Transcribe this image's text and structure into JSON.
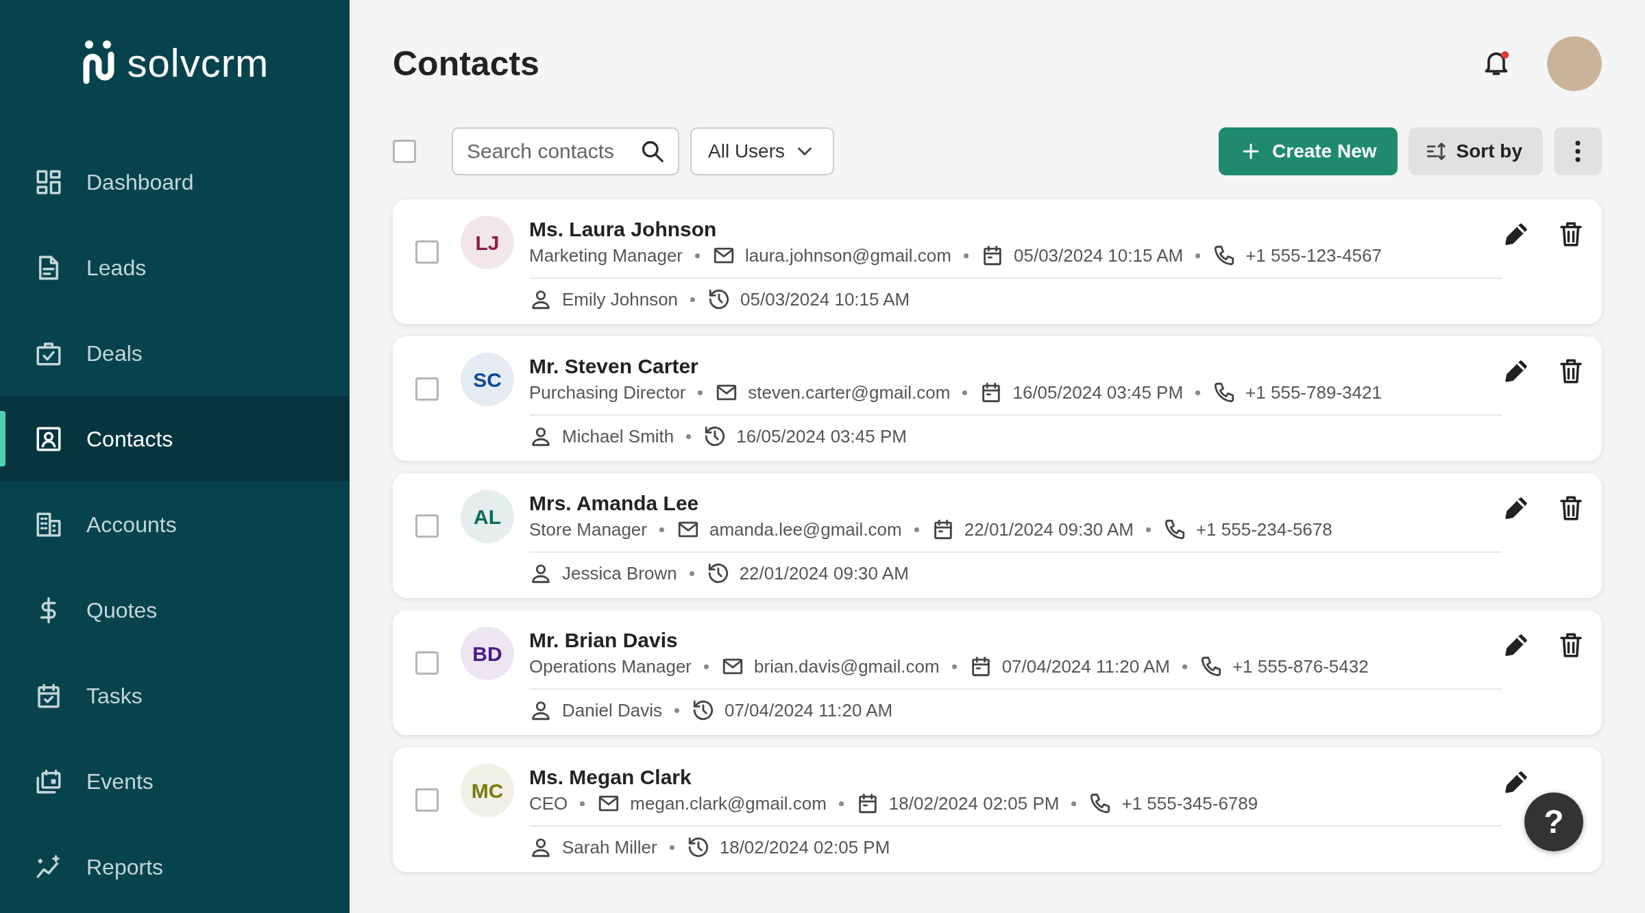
{
  "brand": "solvcrm",
  "nav": [
    {
      "label": "Dashboard",
      "selected": false
    },
    {
      "label": "Leads",
      "selected": false
    },
    {
      "label": "Deals",
      "selected": false
    },
    {
      "label": "Contacts",
      "selected": true
    },
    {
      "label": "Accounts",
      "selected": false
    },
    {
      "label": "Quotes",
      "selected": false
    },
    {
      "label": "Tasks",
      "selected": false
    },
    {
      "label": "Events",
      "selected": false
    },
    {
      "label": "Reports",
      "selected": false
    }
  ],
  "page_title": "Contacts",
  "notifications": {
    "unread": true
  },
  "select_all": {
    "checked": false
  },
  "search": {
    "placeholder": "Search contacts"
  },
  "filter": "All Users",
  "create_button": "Create New",
  "sort_button": "Sort by",
  "contacts": [
    {
      "checked": false,
      "initials": "LJ",
      "color": "#8b1a4a",
      "name": "Ms. Laura Johnson",
      "role": "Marketing Manager",
      "email": "laura.johnson@gmail.com",
      "created": "05/03/2024 10:15 AM",
      "phone": "+1 555-123-4567",
      "owner": "Emily Johnson",
      "updated": "05/03/2024 10:15 AM"
    },
    {
      "checked": false,
      "initials": "SC",
      "color": "#0d4a94",
      "name": "Mr. Steven Carter",
      "role": "Purchasing Director",
      "email": "steven.carter@gmail.com",
      "created": "16/05/2024 03:45 PM",
      "phone": "+1 555-789-3421",
      "owner": "Michael Smith",
      "updated": "16/05/2024 03:45 PM"
    },
    {
      "checked": false,
      "initials": "AL",
      "color": "#0b6b5a",
      "name": "Mrs. Amanda Lee",
      "role": "Store Manager",
      "email": "amanda.lee@gmail.com",
      "created": "22/01/2024 09:30 AM",
      "phone": "+1 555-234-5678",
      "owner": "Jessica Brown",
      "updated": "22/01/2024 09:30 AM"
    },
    {
      "checked": false,
      "initials": "BD",
      "color": "#4a1a8c",
      "name": "Mr. Brian Davis",
      "role": "Operations Manager",
      "email": "brian.davis@gmail.com",
      "created": "07/04/2024 11:20 AM",
      "phone": "+1 555-876-5432",
      "owner": "Daniel Davis",
      "updated": "07/04/2024 11:20 AM"
    },
    {
      "checked": false,
      "initials": "MC",
      "color": "#7a7a10",
      "name": "Ms. Megan Clark",
      "role": "CEO",
      "email": "megan.clark@gmail.com",
      "created": "18/02/2024 02:05 PM",
      "phone": "+1 555-345-6789",
      "owner": "Sarah Miller",
      "updated": "18/02/2024 02:05 PM"
    }
  ],
  "help_button": "?"
}
